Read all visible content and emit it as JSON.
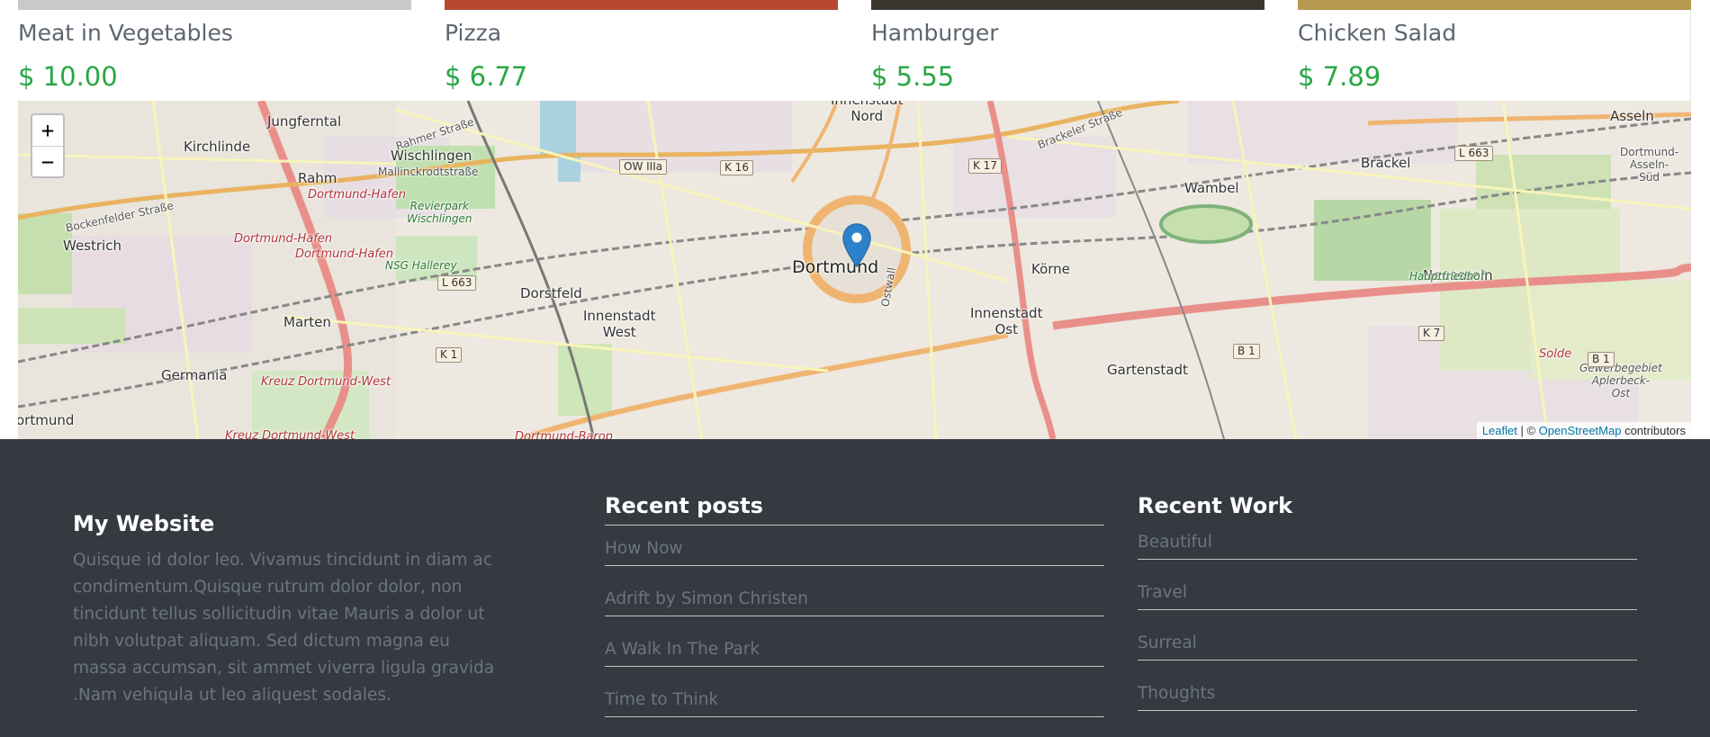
{
  "products": [
    {
      "name": "Meat in Vegetables",
      "price": "$ 10.00",
      "strip_color": "#c9c9c7"
    },
    {
      "name": "Pizza",
      "price": "$ 6.77",
      "strip_color": "#b5482f"
    },
    {
      "name": "Hamburger",
      "price": "$ 5.55",
      "strip_color": "#3b3530"
    },
    {
      "name": "Chicken Salad",
      "price": "$ 7.89",
      "strip_color": "#b79a52"
    }
  ],
  "map": {
    "zoom_in_label": "+",
    "zoom_out_label": "−",
    "attribution": {
      "leaflet": "Leaflet",
      "separator": " | © ",
      "osm": "OpenStreetMap",
      "suffix": " contributors"
    },
    "places": {
      "dortmund": "Dortmund",
      "jungferntal": "Jungferntal",
      "kirchlinde": "Kirchlinde",
      "rahm": "Rahm",
      "wischlingen": "Wischlingen",
      "westrich": "Westrich",
      "marten": "Marten",
      "germania": "Germania",
      "ortmund": "ortmund",
      "dorstfeld": "Dorstfeld",
      "innenstadt_west": "Innenstadt\nWest",
      "innenstadt_nord": "Innenstadt\nNord",
      "innenstadt_ost": "Innenstadt\nOst",
      "korne": "Körne",
      "wambel": "Wambel",
      "brackel": "Brackel",
      "asseln": "Asseln",
      "neuasseln": "Neuasseln",
      "gartenstadt": "Gartenstadt",
      "dortmund_asseln_sud": "Dortmund-\nAsseln-\nSüd",
      "gewerbegebiet": "Gewerbegebiet\nAplerbeck-\nOst",
      "dortmund_hafen": "Dortmund-Hafen",
      "dortmund_hafen2": "Dortmund-Hafen",
      "dortmund_hafen3": "Dortmund-Hafen",
      "kreuz_west": "Kreuz Dortmund-West",
      "kreuz_west2": "Kreuz Dortmund-West",
      "revierpark": "Revierpark\nWischlingen",
      "nsg_hallerey": "NSG Hallerey",
      "hauptfriedhof": "Hauptfriedhof",
      "rahmer_strasse": "Rahmer Straße",
      "mallinckrodtstrasse": "Mallinckrodtstraße",
      "bockenfelder": "Bockenfelder Straße",
      "brackeler": "Brackeler Straße",
      "ostwall": "Ostwall",
      "solde": "Solde",
      "dortmund_barop": "Dortmund-Barop"
    },
    "shields": {
      "ow3a": "OW IIIa",
      "k16": "K 16",
      "k17": "K 17",
      "l663a": "L 663",
      "l663b": "L 663",
      "k1": "K 1",
      "b1a": "B 1",
      "b1b": "B 1",
      "k7": "K 7"
    }
  },
  "footer": {
    "about": {
      "title": "My Website",
      "text": "Quisque id dolor leo. Vivamus tincidunt in diam ac condimentum.Quisque rutrum dolor dolor, non tincidunt tellus sollicitudin vitae Mauris a dolor ut nibh volutpat aliquam. Sed dictum magna eu massa accumsan, sit ammet viverra ligula gravida .Nam vehiqula ut leo aliquest sodales."
    },
    "recent_posts": {
      "title": "Recent posts",
      "items": [
        "How Now",
        "Adrift by Simon Christen",
        "A Walk In The Park",
        "Time to Think"
      ]
    },
    "recent_work": {
      "title": "Recent Work",
      "items": [
        "Beautiful",
        "Travel",
        "Surreal",
        "Thoughts"
      ]
    }
  }
}
